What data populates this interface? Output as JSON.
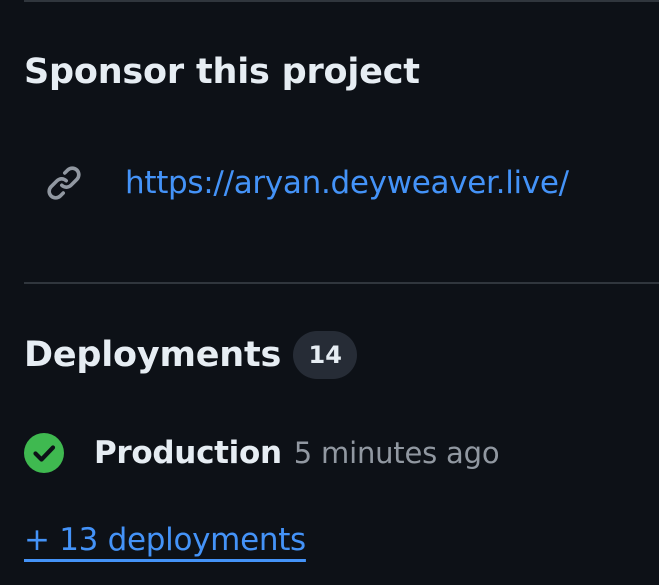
{
  "sponsor": {
    "title": "Sponsor this project",
    "link_icon": "link-icon",
    "link_text": "https://aryan.deyweaver.live/"
  },
  "deployments": {
    "title": "Deployments",
    "count": "14",
    "items": [
      {
        "status_icon": "check-circle-fill-icon",
        "environment": "Production",
        "time": "5 minutes ago"
      }
    ],
    "more_link": "+ 13 deployments"
  },
  "colors": {
    "background": "#0d1117",
    "text": "#e6edf3",
    "muted": "#9198a1",
    "link": "#4493f8",
    "success": "#3fb950",
    "counter_bg": "#262c36",
    "border": "#30363d"
  }
}
